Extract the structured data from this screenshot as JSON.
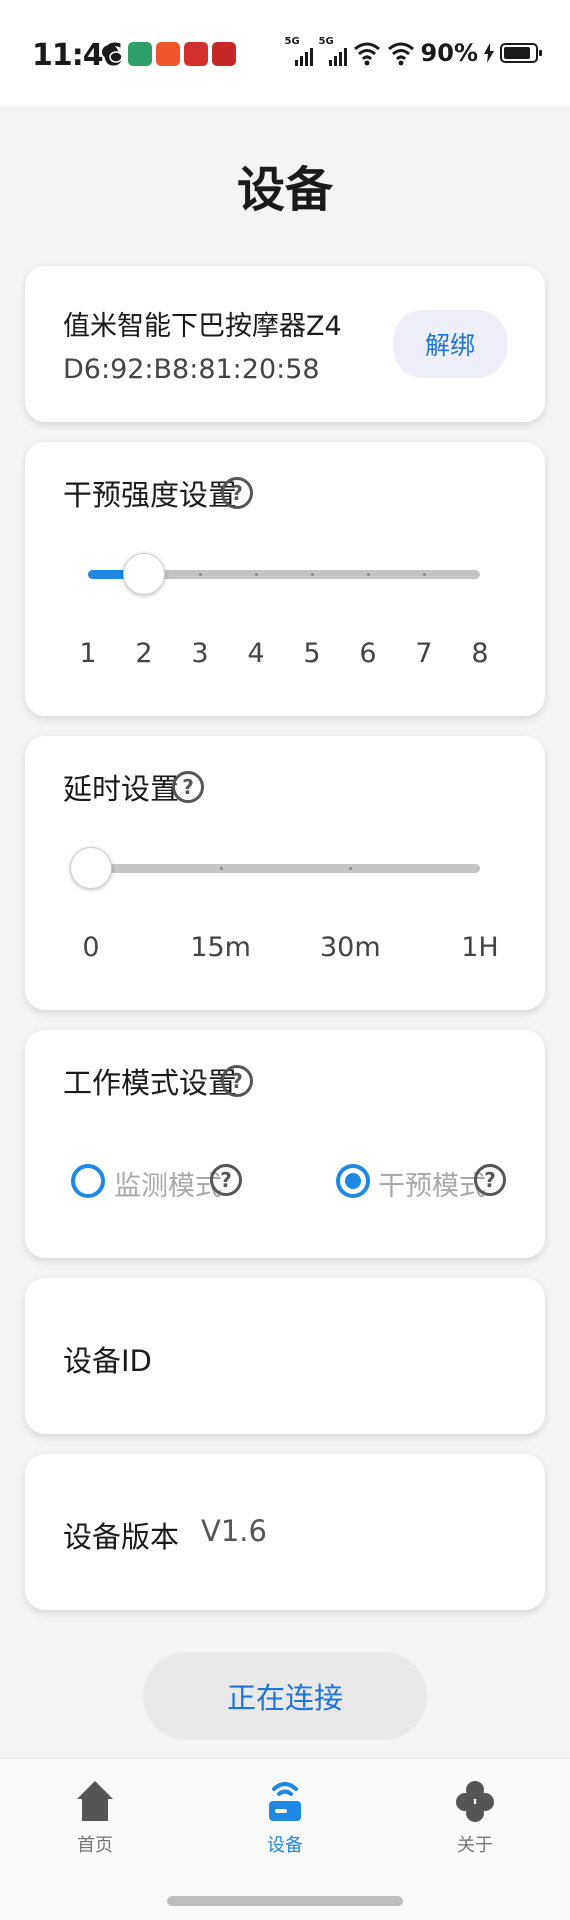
{
  "status": {
    "time": "11:46",
    "signal_labels": [
      "5G",
      "5G"
    ],
    "battery": "90%",
    "battery_level": 0.9
  },
  "page": {
    "title": "设备"
  },
  "device": {
    "name": "值米智能下巴按摩器Z4",
    "mac": "D6:92:B8:81:20:58",
    "unbind_label": "解绑"
  },
  "intensity": {
    "label": "干预强度设置",
    "help": "?",
    "min": 1,
    "max": 8,
    "value": 2,
    "ticks": [
      "1",
      "2",
      "3",
      "4",
      "5",
      "6",
      "7",
      "8"
    ]
  },
  "delay": {
    "label": "延时设置",
    "help": "?",
    "ticks": [
      "0",
      "15m",
      "30m",
      "1H"
    ],
    "value_index": 0
  },
  "mode": {
    "label": "工作模式设置",
    "help": "?",
    "options": [
      {
        "label": "监测模式",
        "selected": false
      },
      {
        "label": "干预模式",
        "selected": true
      }
    ]
  },
  "device_id": {
    "label": "设备ID",
    "value": ""
  },
  "device_version": {
    "label": "设备版本",
    "value": "V1.6"
  },
  "connect_label": "正在连接",
  "nav": {
    "items": [
      {
        "label": "首页",
        "icon": "home-icon",
        "active": false
      },
      {
        "label": "设备",
        "icon": "router-icon",
        "active": true
      },
      {
        "label": "关于",
        "icon": "clover-icon",
        "active": false
      }
    ]
  },
  "colors": {
    "accent": "#1e88e5",
    "button_text": "#1f74d8"
  }
}
